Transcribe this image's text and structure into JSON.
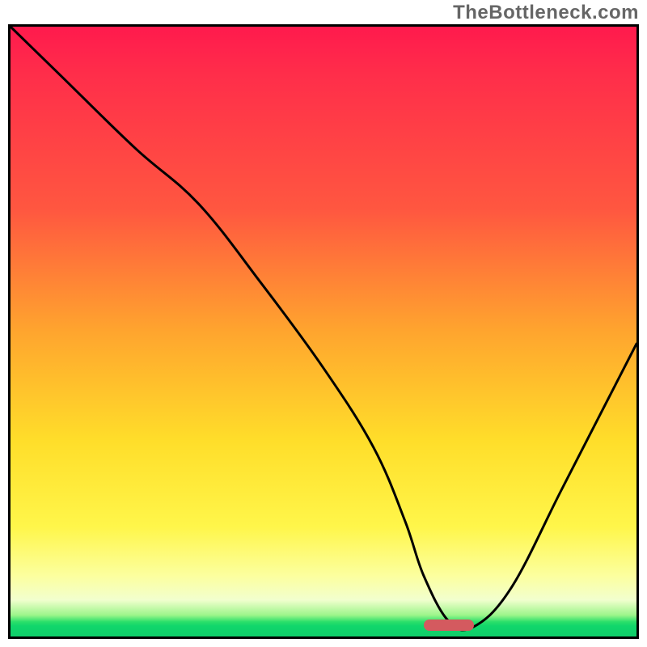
{
  "watermark": "TheBottleneck.com",
  "chart_data": {
    "type": "line",
    "title": "",
    "xlabel": "",
    "ylabel": "",
    "xlim": [
      0,
      100
    ],
    "ylim": [
      0,
      100
    ],
    "grid": false,
    "legend": false,
    "series": [
      {
        "name": "curve",
        "x": [
          0,
          8,
          20,
          30,
          40,
          50,
          58,
          63,
          66,
          70,
          74,
          80,
          88,
          96,
          100
        ],
        "values": [
          100,
          92,
          80,
          71,
          58,
          44,
          31,
          19,
          10,
          2.5,
          1.6,
          8,
          24,
          40,
          48
        ]
      }
    ],
    "annotations": {
      "optimal_marker": {
        "x_start": 66,
        "x_end": 74,
        "y": 1.8
      }
    },
    "background_gradient": {
      "direction": "vertical",
      "stops": [
        {
          "pos": 0,
          "color": "#ff1a4d"
        },
        {
          "pos": 0.3,
          "color": "#ff5740"
        },
        {
          "pos": 0.5,
          "color": "#ffa52e"
        },
        {
          "pos": 0.7,
          "color": "#ffde2a"
        },
        {
          "pos": 0.9,
          "color": "#fcff9e"
        },
        {
          "pos": 0.965,
          "color": "#9cf58a"
        },
        {
          "pos": 1.0,
          "color": "#0fce6a"
        }
      ]
    }
  },
  "frame": {
    "inner_w": 774,
    "inner_h": 754
  }
}
